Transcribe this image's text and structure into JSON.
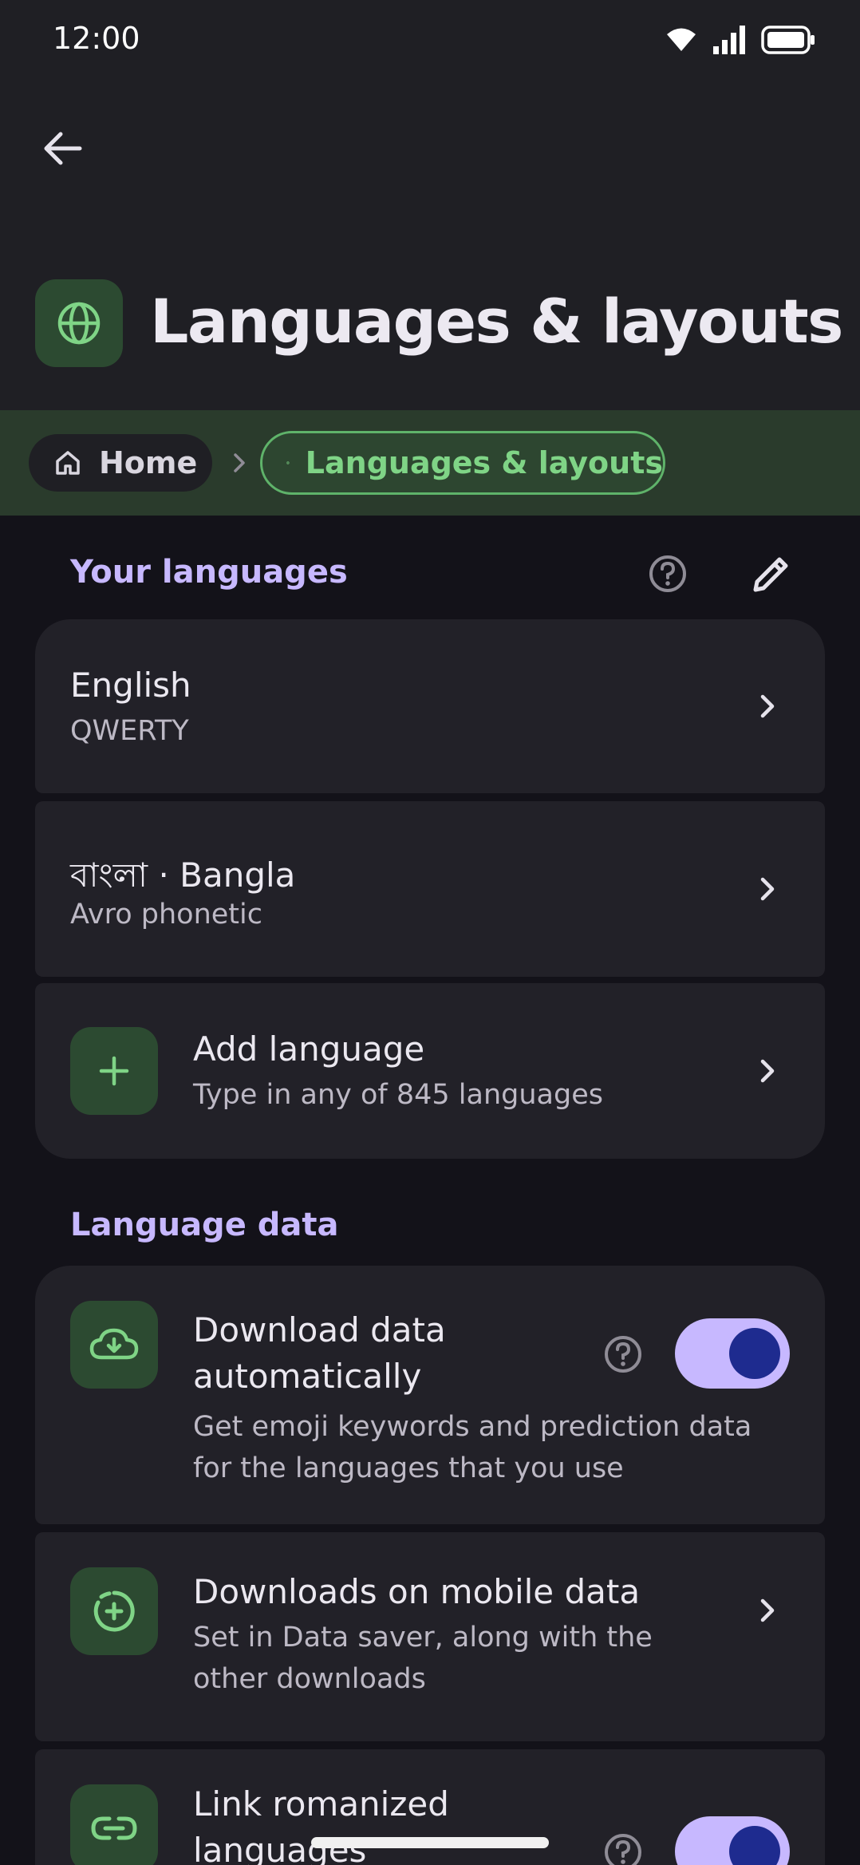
{
  "status_bar": {
    "time": "12:00"
  },
  "app_bar": {
    "title": "Languages & layouts"
  },
  "breadcrumb": {
    "home_label": "Home",
    "current_label": "Languages & layouts"
  },
  "your_languages": {
    "header": "Your languages",
    "items": [
      {
        "title": "English",
        "subtitle": "QWERTY"
      },
      {
        "title": "বাংলা · Bangla",
        "subtitle": "Avro phonetic"
      }
    ],
    "add": {
      "title": "Add language",
      "subtitle": "Type in any of 845 languages"
    }
  },
  "language_data": {
    "header": "Language data",
    "download_auto": {
      "title_line1": "Download data",
      "title_line2": "automatically",
      "subtitle_line1": "Get emoji keywords and prediction data",
      "subtitle_line2": "for the languages that you use",
      "enabled": true
    },
    "mobile_data": {
      "title": "Downloads on mobile data",
      "subtitle_line1": "Set in Data saver, along with the",
      "subtitle_line2": "other downloads"
    },
    "link_romanized": {
      "title_line1": "Link romanized",
      "title_line2": "languages",
      "enabled": true
    }
  },
  "colors": {
    "accent_purple": "#c7b8ff",
    "accent_green": "#7fd486",
    "background": "#131219",
    "surface": "#222128"
  }
}
